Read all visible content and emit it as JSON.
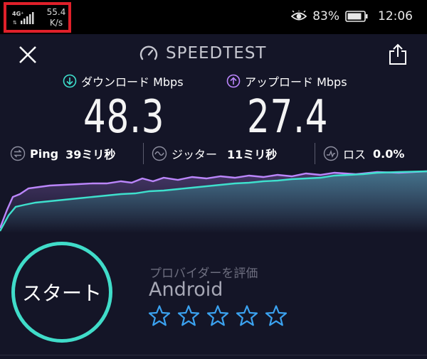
{
  "status_bar": {
    "network_type": "4G⁺",
    "net_speed_value": "55.4",
    "net_speed_unit": "K/s",
    "battery_percent": "83%",
    "time": "12:06"
  },
  "header": {
    "brand": "SPEEDTEST"
  },
  "download": {
    "label": "ダウンロード Mbps",
    "value": "48.3",
    "color": "#3ee0cd"
  },
  "upload": {
    "label": "アップロード Mbps",
    "value": "27.4",
    "color": "#bb86fc"
  },
  "stats": {
    "ping_label": "Ping",
    "ping_value": "39ミリ秒",
    "jitter_label": "ジッター",
    "jitter_value": "11ミリ秒",
    "loss_label": "ロス",
    "loss_value": "0.0%"
  },
  "start": {
    "label": "スタート"
  },
  "provider": {
    "rate_label": "プロバイダーを評価",
    "name": "Android",
    "stars_total": 5,
    "stars_selected": 0
  },
  "colors": {
    "background": "#141527",
    "accent_teal": "#40dcc9",
    "accent_purple": "#bb86fc",
    "highlight_red": "#e0202a"
  }
}
